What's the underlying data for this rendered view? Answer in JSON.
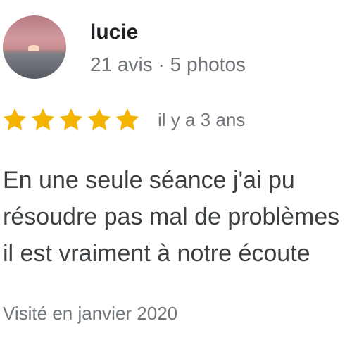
{
  "author": {
    "name": "lucie",
    "meta": "21 avis · 5 photos"
  },
  "rating": {
    "stars": 5,
    "max_stars": 5,
    "star_color": "#f4b400",
    "time_ago": "il y a 3 ans"
  },
  "review": {
    "lines": [
      "En une seule séance j'ai pu",
      "résoudre pas mal de problèmes",
      "il est vraiment à notre écoute"
    ]
  },
  "visit": {
    "label": "Visité en janvier 2020"
  }
}
